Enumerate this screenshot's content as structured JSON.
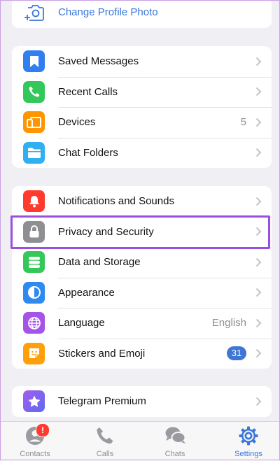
{
  "profile": {
    "change_photo_label": "Change Profile Photo"
  },
  "group_general": [
    {
      "label": "Saved Messages",
      "icon": "bookmark-icon",
      "color": "#2f7ff0",
      "value": ""
    },
    {
      "label": "Recent Calls",
      "icon": "phone-icon",
      "color": "#34c759",
      "value": ""
    },
    {
      "label": "Devices",
      "icon": "devices-icon",
      "color": "#ff9500",
      "value": "5"
    },
    {
      "label": "Chat Folders",
      "icon": "folder-icon",
      "color": "#30b0f0",
      "value": ""
    }
  ],
  "group_settings": [
    {
      "label": "Notifications and Sounds",
      "icon": "bell-icon",
      "color": "#ff3b30",
      "value": ""
    },
    {
      "label": "Privacy and Security",
      "icon": "lock-icon",
      "color": "#8e8e93",
      "value": ""
    },
    {
      "label": "Data and Storage",
      "icon": "database-icon",
      "color": "#34c759",
      "value": ""
    },
    {
      "label": "Appearance",
      "icon": "half-circle-icon",
      "color": "#2f8af0",
      "value": ""
    },
    {
      "label": "Language",
      "icon": "globe-icon",
      "color": "#a454e8",
      "value": "English"
    },
    {
      "label": "Stickers and Emoji",
      "icon": "sticker-icon",
      "color": "#ff9f0a",
      "badge": "31"
    }
  ],
  "group_premium": [
    {
      "label": "Telegram Premium",
      "icon": "star-icon",
      "color": "#7a5cf0"
    }
  ],
  "tabbar": {
    "contacts": {
      "label": "Contacts",
      "badge": "!"
    },
    "calls": {
      "label": "Calls"
    },
    "chats": {
      "label": "Chats"
    },
    "settings": {
      "label": "Settings"
    }
  },
  "colors": {
    "accent": "#3a76d8",
    "highlight": "#9b4fe0",
    "background": "#efeff4"
  }
}
